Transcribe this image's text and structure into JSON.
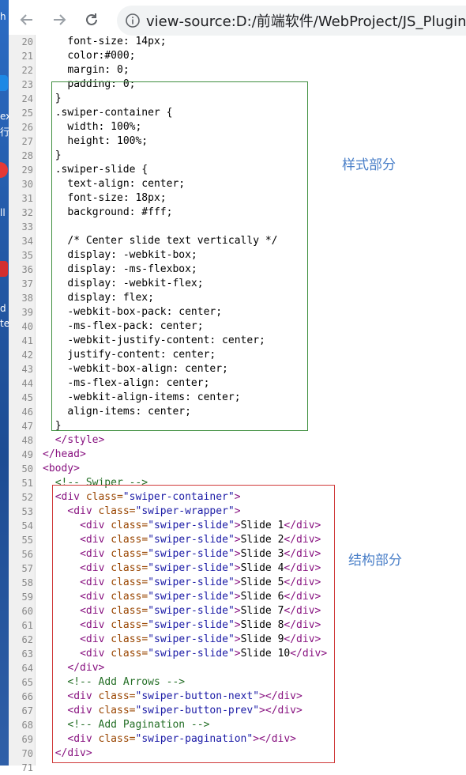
{
  "browser": {
    "url": "view-source:D:/前端软件/WebProject/JS_Plugin/s",
    "back_icon": "arrow-left-icon",
    "forward_icon": "arrow-right-icon",
    "reload_icon": "reload-icon",
    "info_icon": "info-icon"
  },
  "desktop": {
    "labels": [
      "h",
      "ex",
      "行",
      "ll",
      "d",
      "te"
    ]
  },
  "annotations": {
    "style_label": "样式部分",
    "structure_label": "结构部分",
    "style_box_color": "#3f8f3f",
    "structure_box_color": "#d03a3a"
  },
  "lines": [
    {
      "n": "20",
      "s": [
        [
          "font-size: 14px;",
          ""
        ]
      ],
      "i": 4
    },
    {
      "n": "21",
      "s": [
        [
          "color:#000;",
          ""
        ]
      ],
      "i": 4
    },
    {
      "n": "22",
      "s": [
        [
          "margin: 0;",
          ""
        ]
      ],
      "i": 4
    },
    {
      "n": "23",
      "s": [
        [
          "padding: 0;",
          ""
        ]
      ],
      "i": 4
    },
    {
      "n": "24",
      "s": [
        [
          "}",
          ""
        ]
      ],
      "i": 2
    },
    {
      "n": "25",
      "s": [
        [
          ".swiper-container {",
          ""
        ]
      ],
      "i": 2
    },
    {
      "n": "26",
      "s": [
        [
          "width: 100%;",
          ""
        ]
      ],
      "i": 4
    },
    {
      "n": "27",
      "s": [
        [
          "height: 100%;",
          ""
        ]
      ],
      "i": 4
    },
    {
      "n": "28",
      "s": [
        [
          "}",
          ""
        ]
      ],
      "i": 2
    },
    {
      "n": "29",
      "s": [
        [
          ".swiper-slide {",
          ""
        ]
      ],
      "i": 2
    },
    {
      "n": "30",
      "s": [
        [
          "text-align: center;",
          ""
        ]
      ],
      "i": 4
    },
    {
      "n": "31",
      "s": [
        [
          "font-size: 18px;",
          ""
        ]
      ],
      "i": 4
    },
    {
      "n": "32",
      "s": [
        [
          "background: #fff;",
          ""
        ]
      ],
      "i": 4
    },
    {
      "n": "33",
      "s": [],
      "i": 0
    },
    {
      "n": "34",
      "s": [
        [
          "/* Center slide text vertically */",
          ""
        ]
      ],
      "i": 4
    },
    {
      "n": "35",
      "s": [
        [
          "display: -webkit-box;",
          ""
        ]
      ],
      "i": 4
    },
    {
      "n": "36",
      "s": [
        [
          "display: -ms-flexbox;",
          ""
        ]
      ],
      "i": 4
    },
    {
      "n": "37",
      "s": [
        [
          "display: -webkit-flex;",
          ""
        ]
      ],
      "i": 4
    },
    {
      "n": "38",
      "s": [
        [
          "display: flex;",
          ""
        ]
      ],
      "i": 4
    },
    {
      "n": "39",
      "s": [
        [
          "-webkit-box-pack: center;",
          ""
        ]
      ],
      "i": 4
    },
    {
      "n": "40",
      "s": [
        [
          "-ms-flex-pack: center;",
          ""
        ]
      ],
      "i": 4
    },
    {
      "n": "41",
      "s": [
        [
          "-webkit-justify-content: center;",
          ""
        ]
      ],
      "i": 4
    },
    {
      "n": "42",
      "s": [
        [
          "justify-content: center;",
          ""
        ]
      ],
      "i": 4
    },
    {
      "n": "43",
      "s": [
        [
          "-webkit-box-align: center;",
          ""
        ]
      ],
      "i": 4
    },
    {
      "n": "44",
      "s": [
        [
          "-ms-flex-align: center;",
          ""
        ]
      ],
      "i": 4
    },
    {
      "n": "45",
      "s": [
        [
          "-webkit-align-items: center;",
          ""
        ]
      ],
      "i": 4
    },
    {
      "n": "46",
      "s": [
        [
          "align-items: center;",
          ""
        ]
      ],
      "i": 4
    },
    {
      "n": "47",
      "s": [
        [
          "}",
          ""
        ]
      ],
      "i": 2
    },
    {
      "n": "48",
      "s": [
        [
          "</style>",
          "t"
        ]
      ],
      "i": 2
    },
    {
      "n": "49",
      "s": [
        [
          "</head>",
          "t"
        ]
      ],
      "i": 0
    },
    {
      "n": "50",
      "s": [
        [
          "<body>",
          "t"
        ]
      ],
      "i": 0
    },
    {
      "n": "51",
      "s": [
        [
          "<!-- Swiper -->",
          "c"
        ]
      ],
      "i": 2
    },
    {
      "n": "52",
      "s": [
        [
          "<div ",
          "t"
        ],
        [
          "class=",
          "a"
        ],
        [
          "\"swiper-container\"",
          "v"
        ],
        [
          ">",
          "t"
        ]
      ],
      "i": 2
    },
    {
      "n": "53",
      "s": [
        [
          "<div ",
          "t"
        ],
        [
          "class=",
          "a"
        ],
        [
          "\"swiper-wrapper\"",
          "v"
        ],
        [
          ">",
          "t"
        ]
      ],
      "i": 4
    },
    {
      "n": "54",
      "s": [
        [
          "<div ",
          "t"
        ],
        [
          "class=",
          "a"
        ],
        [
          "\"swiper-slide\"",
          "v"
        ],
        [
          ">",
          "t"
        ],
        [
          "Slide 1",
          ""
        ],
        [
          "</div>",
          "t"
        ]
      ],
      "i": 6
    },
    {
      "n": "55",
      "s": [
        [
          "<div ",
          "t"
        ],
        [
          "class=",
          "a"
        ],
        [
          "\"swiper-slide\"",
          "v"
        ],
        [
          ">",
          "t"
        ],
        [
          "Slide 2",
          ""
        ],
        [
          "</div>",
          "t"
        ]
      ],
      "i": 6
    },
    {
      "n": "56",
      "s": [
        [
          "<div ",
          "t"
        ],
        [
          "class=",
          "a"
        ],
        [
          "\"swiper-slide\"",
          "v"
        ],
        [
          ">",
          "t"
        ],
        [
          "Slide 3",
          ""
        ],
        [
          "</div>",
          "t"
        ]
      ],
      "i": 6
    },
    {
      "n": "57",
      "s": [
        [
          "<div ",
          "t"
        ],
        [
          "class=",
          "a"
        ],
        [
          "\"swiper-slide\"",
          "v"
        ],
        [
          ">",
          "t"
        ],
        [
          "Slide 4",
          ""
        ],
        [
          "</div>",
          "t"
        ]
      ],
      "i": 6
    },
    {
      "n": "58",
      "s": [
        [
          "<div ",
          "t"
        ],
        [
          "class=",
          "a"
        ],
        [
          "\"swiper-slide\"",
          "v"
        ],
        [
          ">",
          "t"
        ],
        [
          "Slide 5",
          ""
        ],
        [
          "</div>",
          "t"
        ]
      ],
      "i": 6
    },
    {
      "n": "59",
      "s": [
        [
          "<div ",
          "t"
        ],
        [
          "class=",
          "a"
        ],
        [
          "\"swiper-slide\"",
          "v"
        ],
        [
          ">",
          "t"
        ],
        [
          "Slide 6",
          ""
        ],
        [
          "</div>",
          "t"
        ]
      ],
      "i": 6
    },
    {
      "n": "60",
      "s": [
        [
          "<div ",
          "t"
        ],
        [
          "class=",
          "a"
        ],
        [
          "\"swiper-slide\"",
          "v"
        ],
        [
          ">",
          "t"
        ],
        [
          "Slide 7",
          ""
        ],
        [
          "</div>",
          "t"
        ]
      ],
      "i": 6
    },
    {
      "n": "61",
      "s": [
        [
          "<div ",
          "t"
        ],
        [
          "class=",
          "a"
        ],
        [
          "\"swiper-slide\"",
          "v"
        ],
        [
          ">",
          "t"
        ],
        [
          "Slide 8",
          ""
        ],
        [
          "</div>",
          "t"
        ]
      ],
      "i": 6
    },
    {
      "n": "62",
      "s": [
        [
          "<div ",
          "t"
        ],
        [
          "class=",
          "a"
        ],
        [
          "\"swiper-slide\"",
          "v"
        ],
        [
          ">",
          "t"
        ],
        [
          "Slide 9",
          ""
        ],
        [
          "</div>",
          "t"
        ]
      ],
      "i": 6
    },
    {
      "n": "63",
      "s": [
        [
          "<div ",
          "t"
        ],
        [
          "class=",
          "a"
        ],
        [
          "\"swiper-slide\"",
          "v"
        ],
        [
          ">",
          "t"
        ],
        [
          "Slide 10",
          ""
        ],
        [
          "</div>",
          "t"
        ]
      ],
      "i": 6
    },
    {
      "n": "64",
      "s": [
        [
          "</div>",
          "t"
        ]
      ],
      "i": 4
    },
    {
      "n": "65",
      "s": [
        [
          "<!-- Add Arrows -->",
          "c"
        ]
      ],
      "i": 4
    },
    {
      "n": "66",
      "s": [
        [
          "<div ",
          "t"
        ],
        [
          "class=",
          "a"
        ],
        [
          "\"swiper-button-next\"",
          "v"
        ],
        [
          "></div>",
          "t"
        ]
      ],
      "i": 4
    },
    {
      "n": "67",
      "s": [
        [
          "<div ",
          "t"
        ],
        [
          "class=",
          "a"
        ],
        [
          "\"swiper-button-prev\"",
          "v"
        ],
        [
          "></div>",
          "t"
        ]
      ],
      "i": 4
    },
    {
      "n": "68",
      "s": [
        [
          "<!-- Add Pagination -->",
          "c"
        ]
      ],
      "i": 4
    },
    {
      "n": "69",
      "s": [
        [
          "<div ",
          "t"
        ],
        [
          "class=",
          "a"
        ],
        [
          "\"swiper-pagination\"",
          "v"
        ],
        [
          "></div>",
          "t"
        ]
      ],
      "i": 4
    },
    {
      "n": "70",
      "s": [
        [
          "</div>",
          "t"
        ]
      ],
      "i": 2
    },
    {
      "n": "71",
      "s": [],
      "i": 0
    }
  ]
}
